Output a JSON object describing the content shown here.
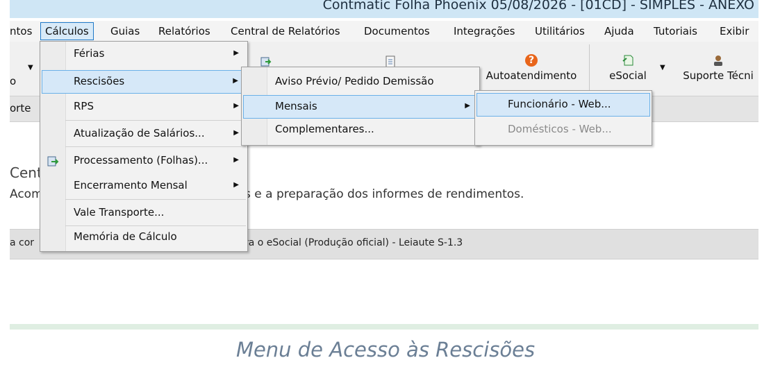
{
  "window": {
    "title": "Contmatic Folha Phoenix 05/08/2026 - [01CD] - SIMPLES - ANEXO"
  },
  "menubar": [
    "ntos",
    "Cálculos",
    "Guias",
    "Relatórios",
    "Central de Relatórios",
    "Documentos",
    "Integrações",
    "Utilitários",
    "Ajuda",
    "Tutoriais",
    "Exibir"
  ],
  "toolbar": {
    "left_label": "o",
    "autoatendimento": "Autoatendimento",
    "esocial": "eSocial",
    "suporte": "Suporte Técni"
  },
  "tab_left": "orte",
  "content": {
    "title": "Cent",
    "desc_start": "Acom",
    "desc_end": "s e a preparação dos informes de rendimentos."
  },
  "statusbar": {
    "left": "a cor",
    "right": "ra o eSocial (Produção oficial) - Leiaute S-1.3"
  },
  "calculos_menu": [
    {
      "label": "Férias",
      "submenu": true
    },
    {
      "label": "Rescisões",
      "submenu": true
    },
    {
      "label": "RPS",
      "submenu": true
    },
    {
      "label": "Atualização de Salários...",
      "submenu": true
    },
    {
      "label": "Processamento (Folhas)...",
      "submenu": true
    },
    {
      "label": "Encerramento Mensal",
      "submenu": true
    },
    {
      "label": "Vale Transporte..."
    },
    {
      "label": "Memória de Cálculo"
    }
  ],
  "rescisoes_menu": [
    {
      "label": "Aviso Prévio/ Pedido Demissão"
    },
    {
      "label": "Mensais",
      "submenu": true
    },
    {
      "label": "Complementares..."
    }
  ],
  "mensais_menu": [
    {
      "label": "Funcionário - Web..."
    },
    {
      "label": "Domésticos - Web...",
      "disabled": true
    }
  ],
  "caption": "Menu de Acesso às Rescisões"
}
